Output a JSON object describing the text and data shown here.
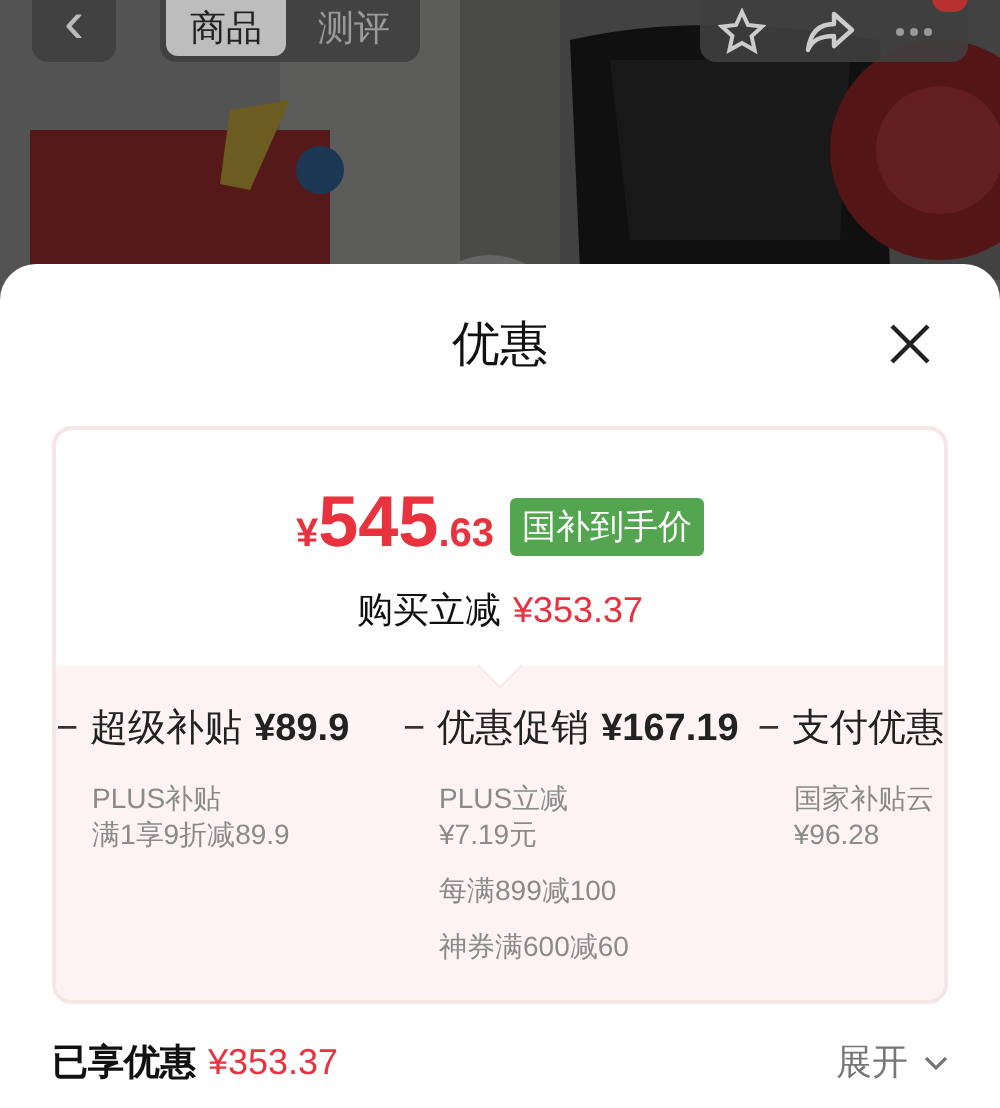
{
  "nav": {
    "back": "‹",
    "tabs": [
      {
        "label": "商品",
        "selected": true
      },
      {
        "label": "测评",
        "selected": false
      }
    ]
  },
  "sheet": {
    "title": "优惠",
    "price": {
      "currency": "¥",
      "integer": "545",
      "decimal": ".63",
      "tag": "国补到手价"
    },
    "reduction": {
      "label": "购买立减",
      "amount": "¥353.37"
    },
    "breakdown": [
      {
        "op": "−",
        "label": "超级补贴",
        "amount": "¥89.9",
        "details": [
          {
            "title": "PLUS补贴",
            "text": "满1享9折减89.9"
          }
        ]
      },
      {
        "op": "−",
        "label": "优惠促销",
        "amount": "¥167.19",
        "details": [
          {
            "title": "PLUS立减",
            "text": "¥7.19元"
          },
          {
            "text": "每满899减100"
          },
          {
            "text": "神券满600减60"
          }
        ]
      },
      {
        "op": "−",
        "label": "支付优惠",
        "details": [
          {
            "title": "国家补贴云",
            "text": "¥96.28"
          }
        ]
      }
    ],
    "footer": {
      "label": "已享优惠",
      "amount": "¥353.37",
      "toggle": "展开",
      "expanded": false
    }
  }
}
